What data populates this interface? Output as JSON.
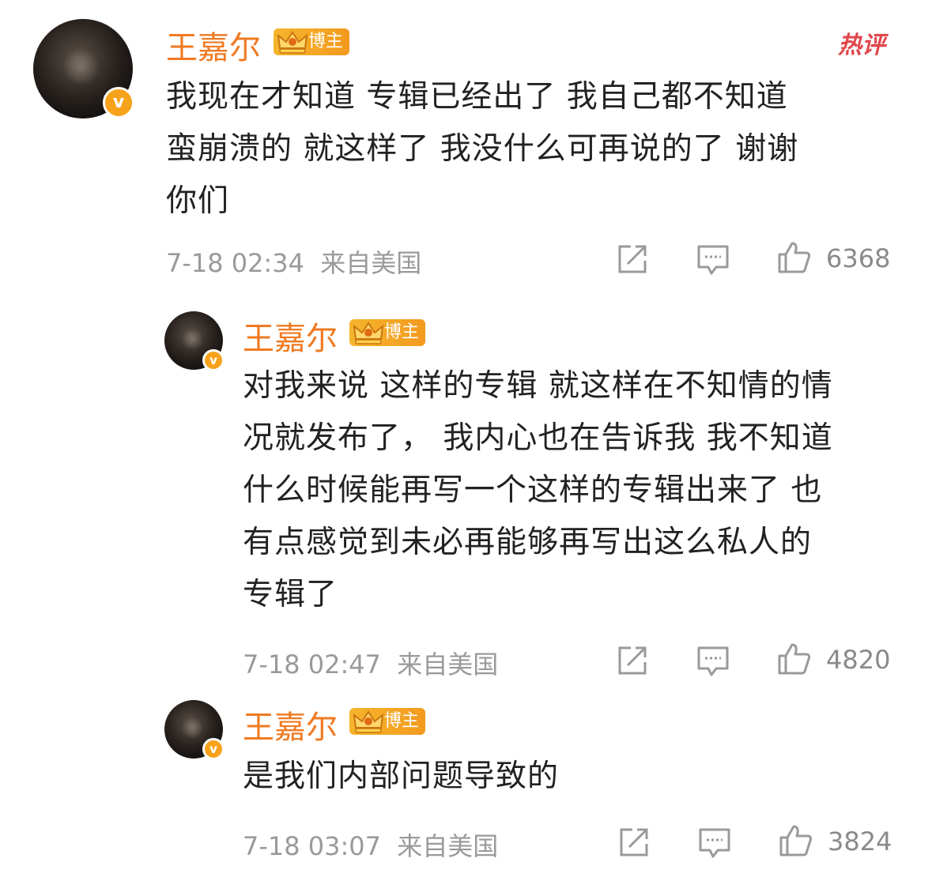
{
  "comments": [
    {
      "username": "王嘉尔",
      "badge": "博主",
      "hot_label": "热评",
      "text_lines": [
        "我现在才知道 专辑已经出了 我自己都不知道",
        "蛮崩溃的  就这样了 我没什么可再说的了  谢谢",
        "你们"
      ],
      "time": "7-18 02:34",
      "location": "来自美国",
      "likes": "6368"
    },
    {
      "username": "王嘉尔",
      "badge": "博主",
      "text_lines": [
        "对我来说 这样的专辑 就这样在不知情的情",
        "况就发布了，  我内心也在告诉我 我不知道",
        "什么时候能再写一个这样的专辑出来了 也",
        "有点感觉到未必再能够再写出这么私人的",
        "专辑了"
      ],
      "time": "7-18 02:47",
      "location": "来自美国",
      "likes": "4820"
    },
    {
      "username": "王嘉尔",
      "badge": "博主",
      "text_lines": [
        "是我们内部问题导致的"
      ],
      "time": "7-18 03:07",
      "location": "来自美国",
      "likes": "3824"
    }
  ],
  "icons": {
    "verified": "v-verified-icon",
    "badge": "crown-icon",
    "share": "share-icon",
    "reply": "comment-icon",
    "like": "thumbs-up-icon"
  },
  "colors": {
    "username": "#f07a22",
    "badge_bg": "#f3a426",
    "hot": "#e0464b",
    "meta": "#9a9a9a",
    "text": "#222222"
  }
}
